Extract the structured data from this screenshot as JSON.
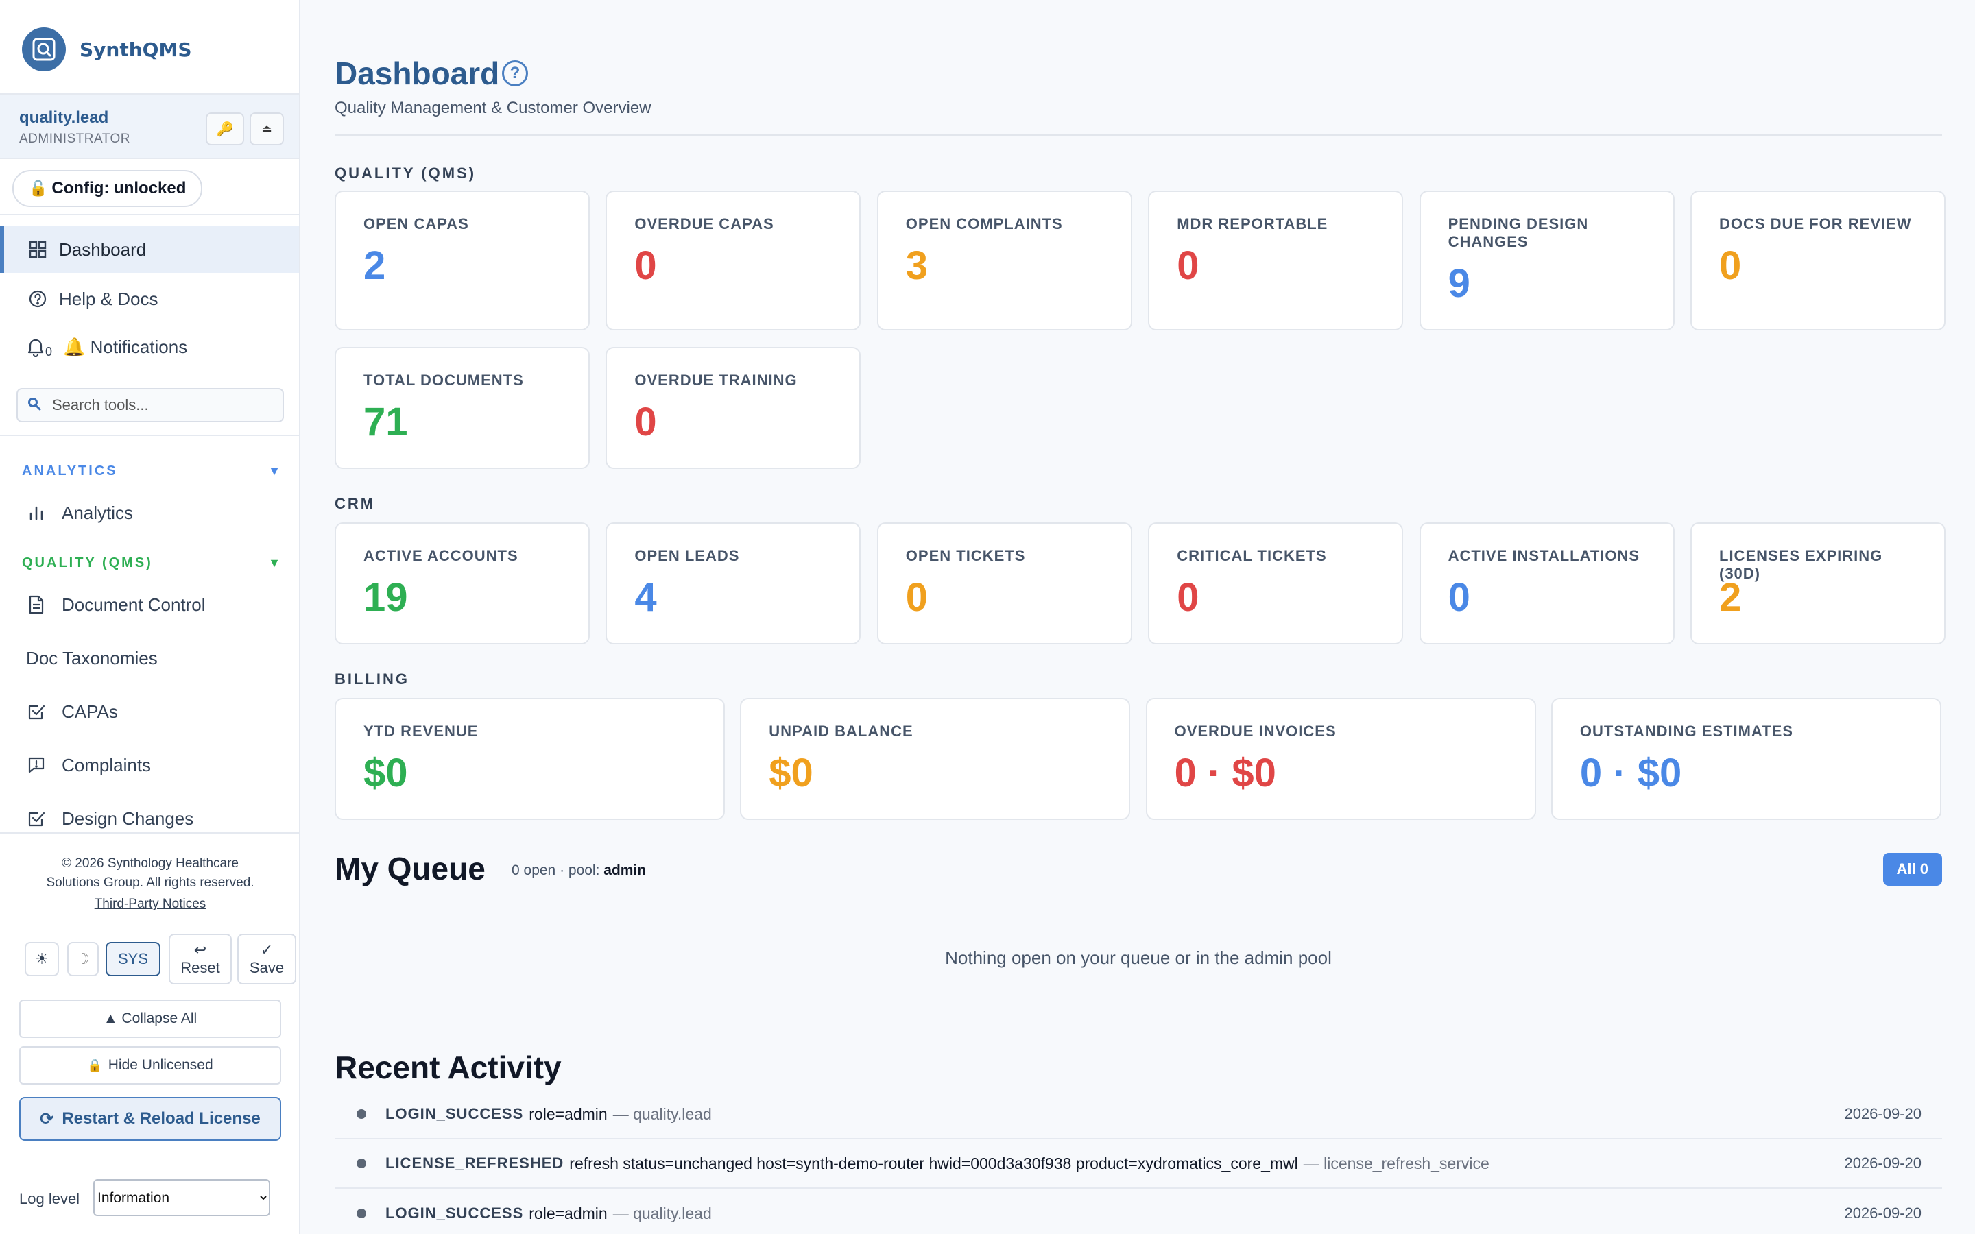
{
  "brand": {
    "name": "SynthQMS"
  },
  "user": {
    "name": "quality.lead",
    "role": "ADMINISTRATOR"
  },
  "config": {
    "label": "Config: unlocked",
    "icon": "🔓"
  },
  "nav": {
    "dashboard": "Dashboard",
    "help": "Help & Docs",
    "notifications_count": "0",
    "notifications": "🔔 Notifications"
  },
  "search": {
    "placeholder": "Search tools..."
  },
  "sections": {
    "analytics": {
      "label": "ANALYTICS",
      "items": [
        "Analytics"
      ],
      "color": "#4a88e6"
    },
    "quality": {
      "label": "QUALITY (QMS)",
      "items": [
        "Document Control",
        "Doc Taxonomies",
        "CAPAs",
        "Complaints",
        "Design Changes"
      ],
      "color": "#2eaf53"
    }
  },
  "footer": {
    "copyright_line1": "© 2026 Synthology Healthcare",
    "copyright_line2": "Solutions Group. All rights reserved.",
    "notices": "Third-Party Notices",
    "theme_sys": "SYS",
    "reset": "Reset",
    "save": "Save",
    "collapse_all": "▲ Collapse All",
    "hide_unlicensed": "Hide Unlicensed",
    "reload": "Restart & Reload License",
    "log_label": "Log level",
    "log_value": "Information"
  },
  "page": {
    "title": "Dashboard",
    "subtitle": "Quality Management & Customer Overview"
  },
  "quality_group": {
    "label": "QUALITY (QMS)",
    "cards": [
      {
        "label": "OPEN CAPAS",
        "value": "2",
        "color": "blue"
      },
      {
        "label": "OVERDUE CAPAS",
        "value": "0",
        "color": "red"
      },
      {
        "label": "OPEN COMPLAINTS",
        "value": "3",
        "color": "orange"
      },
      {
        "label": "MDR REPORTABLE",
        "value": "0",
        "color": "red"
      },
      {
        "label": "PENDING DESIGN CHANGES",
        "value": "9",
        "color": "blue"
      },
      {
        "label": "DOCS DUE FOR REVIEW",
        "value": "0",
        "color": "orange"
      },
      {
        "label": "TOTAL DOCUMENTS",
        "value": "71",
        "color": "green"
      },
      {
        "label": "OVERDUE TRAINING",
        "value": "0",
        "color": "red"
      }
    ]
  },
  "crm_group": {
    "label": "CRM",
    "cards": [
      {
        "label": "ACTIVE ACCOUNTS",
        "value": "19",
        "color": "green"
      },
      {
        "label": "OPEN LEADS",
        "value": "4",
        "color": "blue"
      },
      {
        "label": "OPEN TICKETS",
        "value": "0",
        "color": "orange"
      },
      {
        "label": "CRITICAL TICKETS",
        "value": "0",
        "color": "red"
      },
      {
        "label": "ACTIVE INSTALLATIONS",
        "value": "0",
        "color": "blue"
      },
      {
        "label": "LICENSES EXPIRING (30D)",
        "value": "2",
        "color": "orange"
      }
    ]
  },
  "billing_group": {
    "label": "BILLING",
    "cards": [
      {
        "label": "YTD REVENUE",
        "value": "$0",
        "color": "green"
      },
      {
        "label": "UNPAID BALANCE",
        "value": "$0",
        "color": "orange"
      },
      {
        "label": "OVERDUE INVOICES",
        "value": "0 · $0",
        "color": "red"
      },
      {
        "label": "OUTSTANDING ESTIMATES",
        "value": "0 · $0",
        "color": "blue"
      }
    ]
  },
  "queue": {
    "title": "My Queue",
    "meta_prefix": "0 open · pool:",
    "meta_pool": "admin",
    "badge": "All 0",
    "empty": "Nothing open on your queue or in the admin pool"
  },
  "activity": {
    "title": "Recent Activity",
    "rows": [
      {
        "event": "LOGIN_SUCCESS",
        "detail": "role=admin",
        "actor": "— quality.lead",
        "date": "2026-09-20"
      },
      {
        "event": "LICENSE_REFRESHED",
        "detail": "refresh status=unchanged host=synth-demo-router hwid=000d3a30f938 product=xydromatics_core_mwl",
        "actor": "— license_refresh_service",
        "date": "2026-09-20"
      },
      {
        "event": "LOGIN_SUCCESS",
        "detail": "role=admin",
        "actor": "— quality.lead",
        "date": "2026-09-20"
      }
    ]
  }
}
